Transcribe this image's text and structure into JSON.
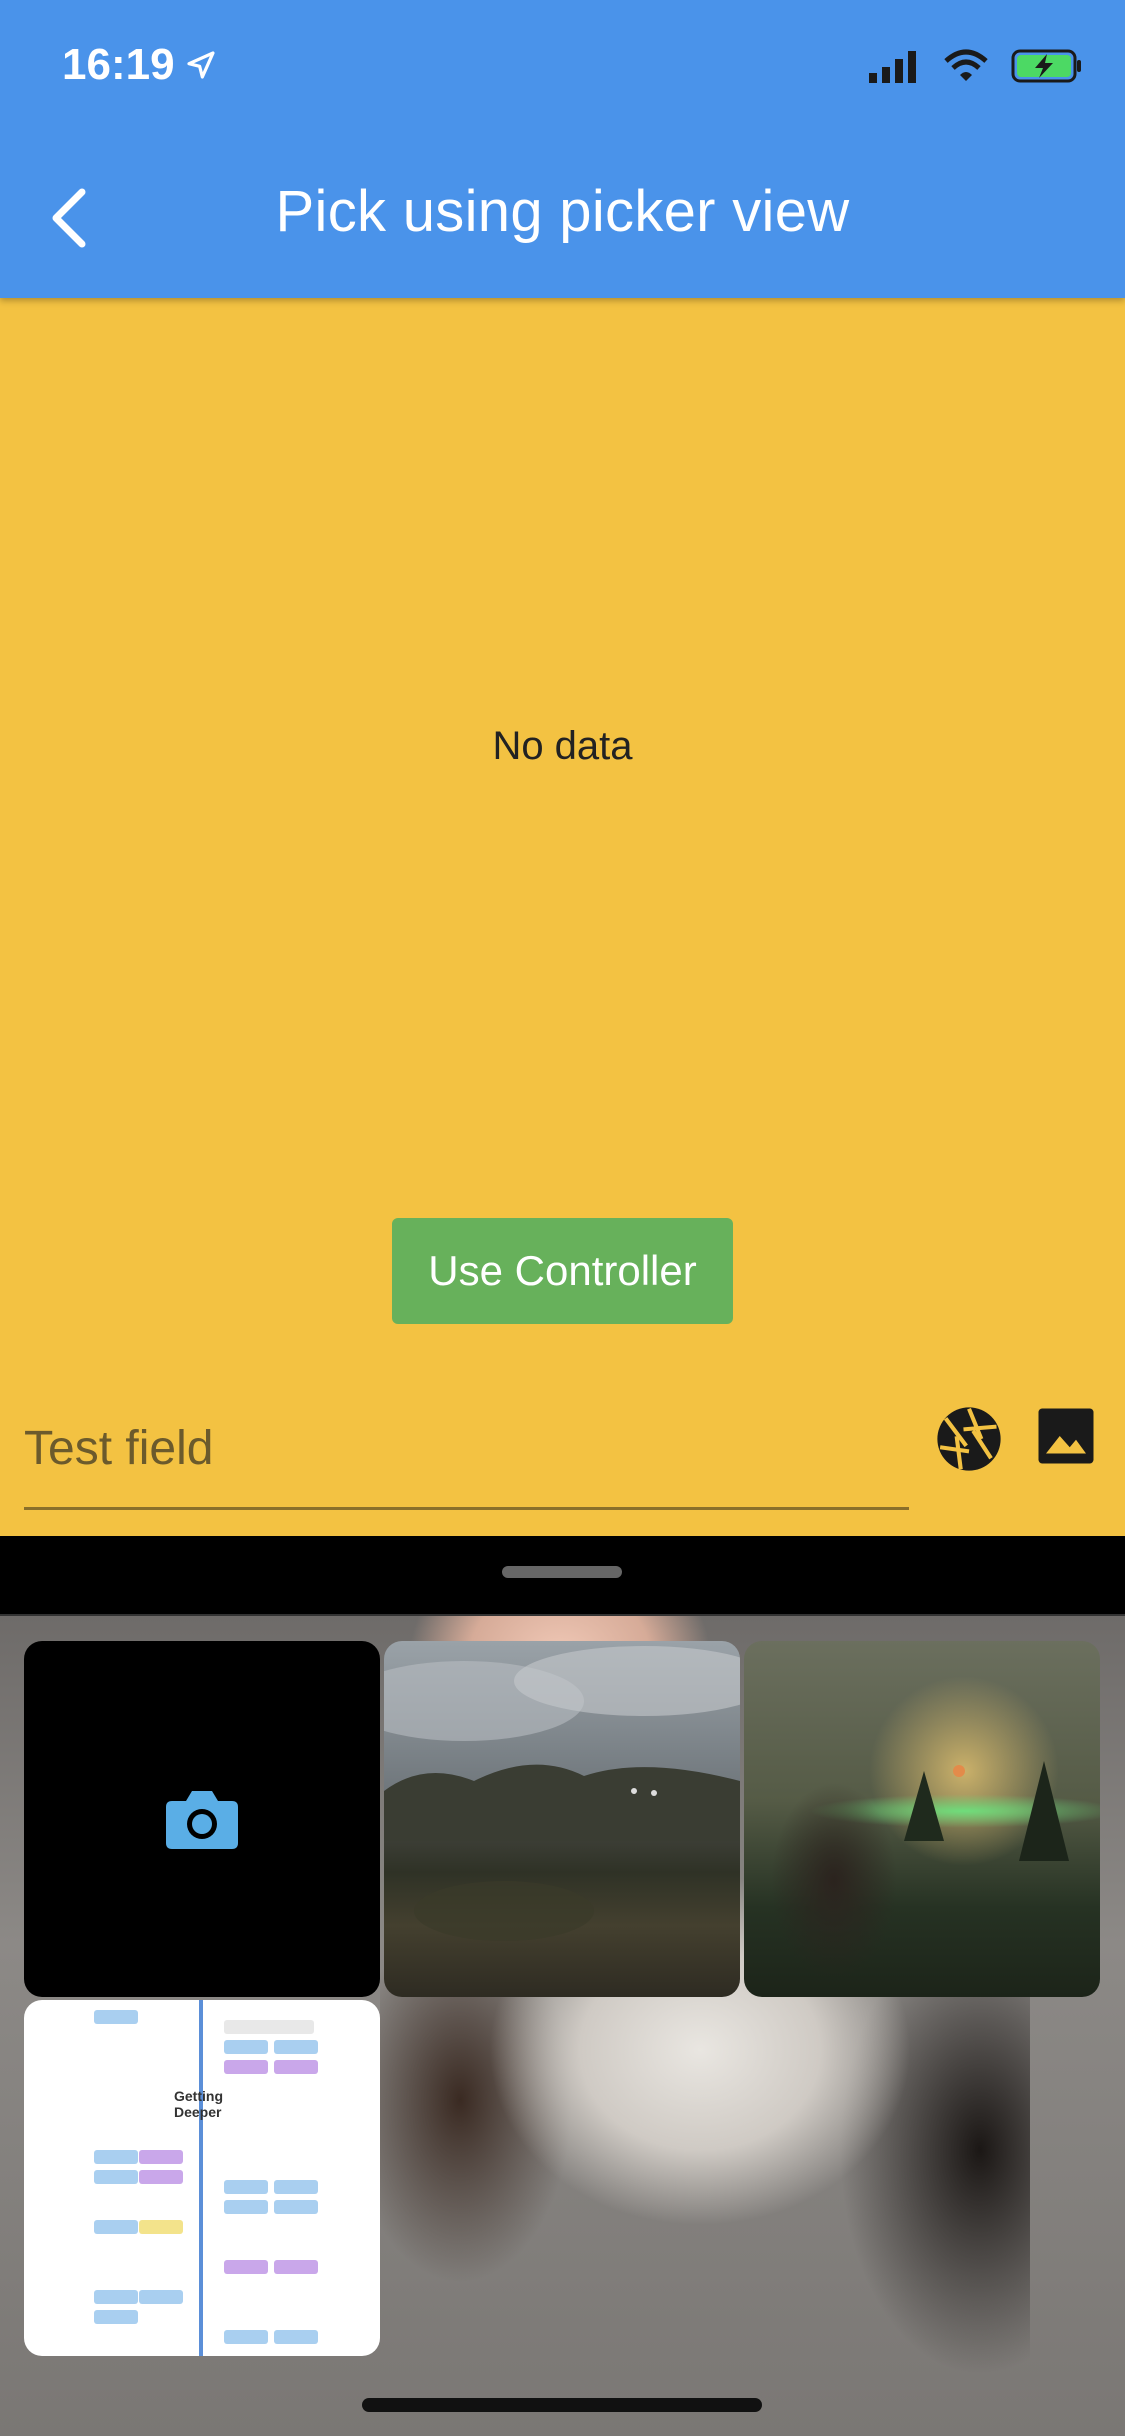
{
  "status": {
    "time": "16:19",
    "icons": [
      "location-arrow-icon",
      "cellular-signal-icon",
      "wifi-icon",
      "battery-charging-icon"
    ]
  },
  "appbar": {
    "title": "Pick using picker view",
    "back_icon": "chevron-left-icon",
    "color": "#4A93EA"
  },
  "content": {
    "background": "#F3C242",
    "empty_text": "No data",
    "button_label": "Use Controller",
    "button_color": "#67B15B",
    "field_placeholder": "Test field",
    "field_value": "",
    "field_icons": [
      "aperture-icon",
      "image-icon"
    ]
  },
  "picker": {
    "tiles": [
      {
        "type": "camera",
        "icon": "camera-icon"
      },
      {
        "type": "photo",
        "label": "landscape-cloudy-hills"
      },
      {
        "type": "photo",
        "label": "night-person-green-lights"
      },
      {
        "type": "photo",
        "label": "document-diagram-getting-deeper"
      }
    ],
    "doc_heading": "Getting\nDeeper"
  }
}
